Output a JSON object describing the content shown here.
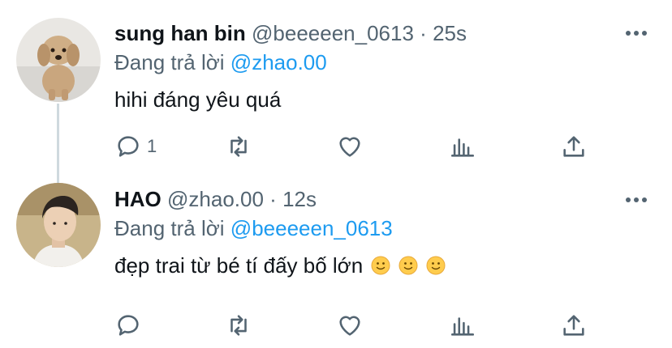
{
  "tweets": [
    {
      "name": "sung han bin",
      "handle": "@beeeeen_0613",
      "separator": "·",
      "time": "25s",
      "replying_prefix": "Đang trả lời",
      "replying_to": "@zhao.00",
      "text": "hihi đáng yêu quá",
      "reply_count": "1"
    },
    {
      "name": "HAO",
      "handle": "@zhao.00",
      "separator": "·",
      "time": "12s",
      "replying_prefix": "Đang trả lời",
      "replying_to": "@beeeeen_0613",
      "text": "đẹp trai từ bé tí đấy bố lớn",
      "emoji_count": 3
    }
  ],
  "colors": {
    "accent": "#1d9bf0",
    "secondary_text": "#536471",
    "icon": "#536471",
    "thread_line": "#cfd9de"
  }
}
